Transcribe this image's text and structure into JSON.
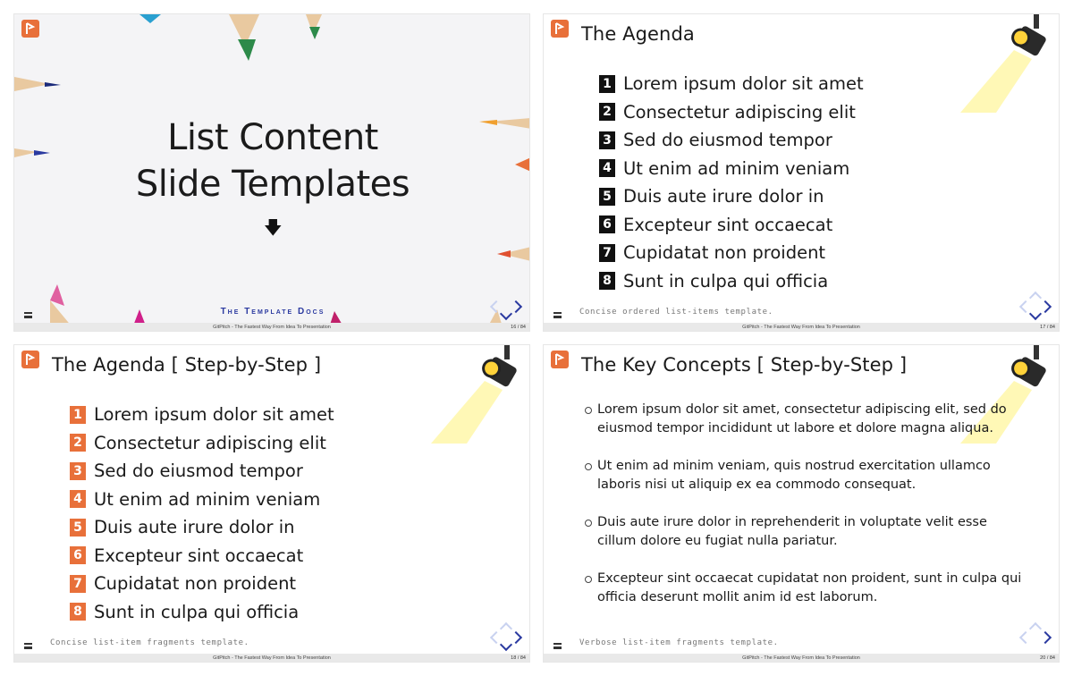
{
  "slides": [
    {
      "id": "s1",
      "title_line1": "List Content",
      "title_line2": "Slide Templates",
      "brand": "The Template Docs",
      "footer": "GitPitch - The Fastest Way From Idea To Presentation",
      "page": "16 / 84"
    },
    {
      "id": "s2",
      "title": "The Agenda",
      "items": [
        "Lorem ipsum dolor sit amet",
        "Consectetur adipiscing elit",
        "Sed do eiusmod tempor",
        "Ut enim ad minim veniam",
        "Duis aute irure dolor in",
        "Excepteur sint occaecat",
        "Cupidatat non proident",
        "Sunt in culpa qui officia"
      ],
      "numbers": [
        "1",
        "2",
        "3",
        "4",
        "5",
        "6",
        "7",
        "8"
      ],
      "caption": "Concise ordered list-items template.",
      "footer": "GitPitch - The Fastest Way From Idea To Presentation",
      "page": "17 / 84"
    },
    {
      "id": "s3",
      "title": "The Agenda [ Step-by-Step ]",
      "items": [
        "Lorem ipsum dolor sit amet",
        "Consectetur adipiscing elit",
        "Sed do eiusmod tempor",
        "Ut enim ad minim veniam",
        "Duis aute irure dolor in",
        "Excepteur sint occaecat",
        "Cupidatat non proident",
        "Sunt in culpa qui officia"
      ],
      "numbers": [
        "1",
        "2",
        "3",
        "4",
        "5",
        "6",
        "7",
        "8"
      ],
      "caption": "Concise list-item fragments template.",
      "footer": "GitPitch - The Fastest Way From Idea To Presentation",
      "page": "18 / 84"
    },
    {
      "id": "s4",
      "title": "The Key Concepts [ Step-by-Step ]",
      "items": [
        "Lorem ipsum dolor sit amet, consectetur adipiscing elit, sed do eiusmod tempor incididunt ut labore et dolore magna aliqua.",
        "Ut enim ad minim veniam, quis nostrud exercitation ullamco laboris nisi ut aliquip ex ea commodo consequat.",
        "Duis aute irure dolor in reprehenderit in voluptate velit esse cillum dolore eu fugiat nulla pariatur.",
        "Excepteur sint occaecat cupidatat non proident, sunt in culpa qui officia deserunt mollit anim id est laborum."
      ],
      "caption": "Verbose list-item fragments template.",
      "footer": "GitPitch - The Fastest Way From Idea To Presentation",
      "page": "20 / 84"
    }
  ],
  "colors": {
    "accent_orange": "#e8703a",
    "nav_blue": "#2b3aa0",
    "nav_dim": "#c9d2f0",
    "spotlight": "#fff27a"
  },
  "icons": [
    "gitpitch-logo-icon",
    "menu-icon",
    "arrow-down-icon",
    "spotlight-icon",
    "nav-arrows-icon"
  ]
}
